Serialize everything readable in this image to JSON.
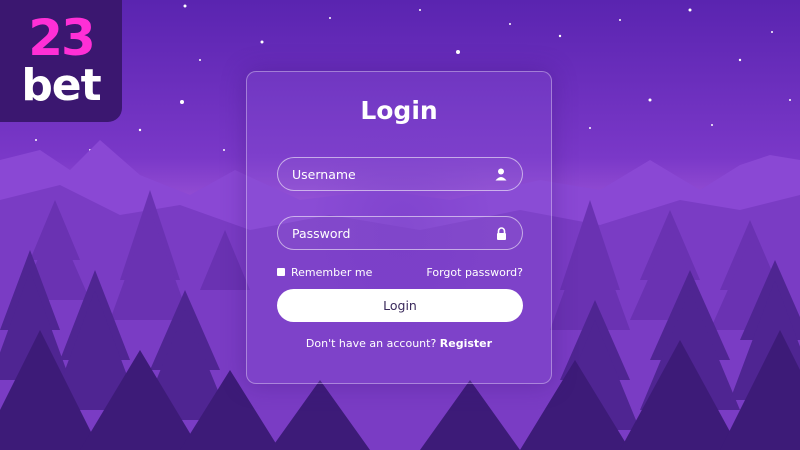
{
  "brand": {
    "logo_number": "23",
    "logo_word": "bet"
  },
  "login_card": {
    "title": "Login",
    "username_placeholder": "Username",
    "username_icon": "user-icon",
    "password_placeholder": "Password",
    "password_icon": "lock-icon",
    "remember_label": "Remember me",
    "forgot_label": "Forgot password?",
    "login_button_label": "Login",
    "no_account_text": "Don't have an account?",
    "register_label": "Register"
  },
  "colors": {
    "sky_top": "#6a2fc0",
    "sky_bottom": "#c47ae6",
    "logo_bg": "#3b1770",
    "logo_number": "#ff2fd6",
    "button_text": "#3a2a5c"
  }
}
